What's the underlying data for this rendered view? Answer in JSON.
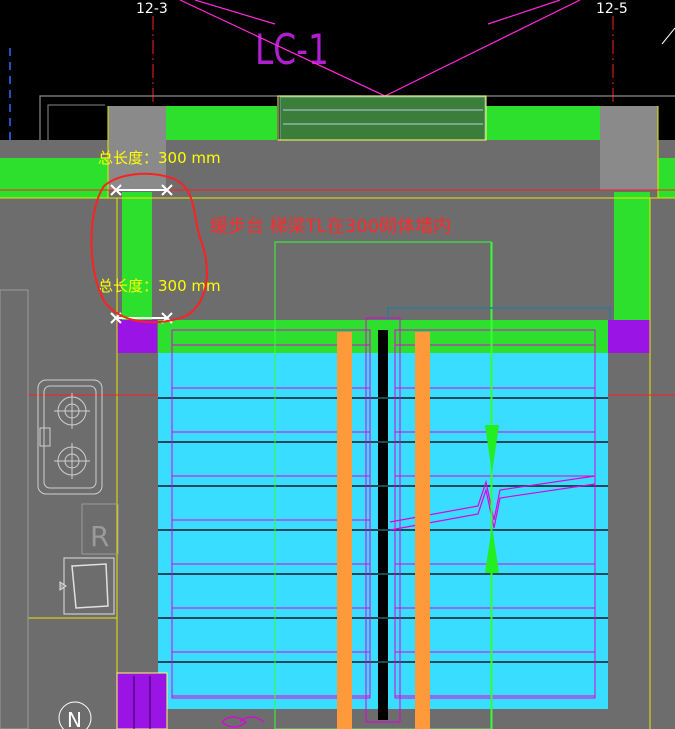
{
  "grid_labels": {
    "left": "12-3",
    "right": "12-5"
  },
  "window_tag": "LC-1",
  "dimensions": {
    "top": "总长度：300 mm",
    "bottom": "总长度：300 mm"
  },
  "annotation": "缓步台 梯梁TL在300砌体墙内",
  "fixture_label": "R",
  "north_symbol": "N",
  "colors": {
    "background": "#000000",
    "wall_green": "#2ee02e",
    "slab_gray": "#6d6d6d",
    "column_gray": "#8a8a8a",
    "stair_cyan": "#38ddff",
    "beam_orange": "#ff9a3a",
    "post_purple": "#9a14e6",
    "markup_red": "#ff2a2a",
    "text_yellow": "#ffff00",
    "line_magenta": "#e000e0"
  }
}
